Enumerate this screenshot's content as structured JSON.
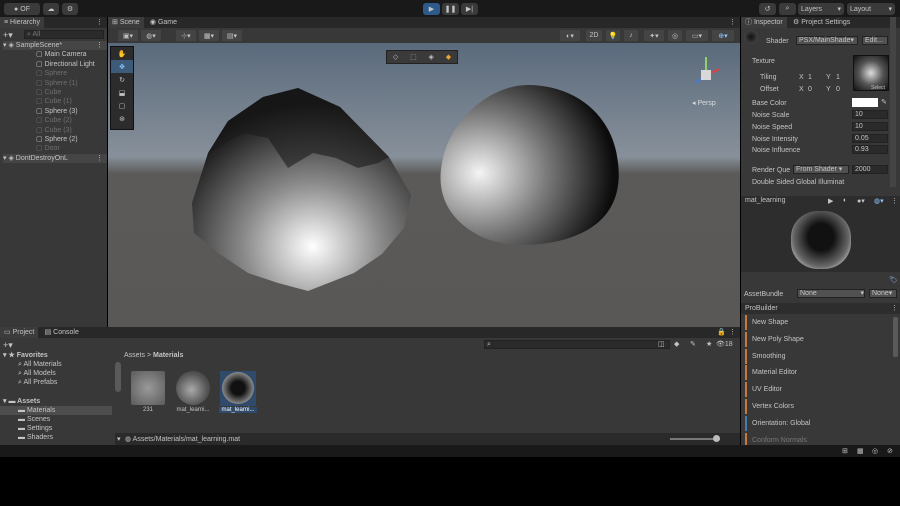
{
  "top_bar": {
    "account_label": "OF",
    "right_buttons": [
      "Layers",
      "Layout"
    ]
  },
  "hierarchy": {
    "title": "Hierarchy",
    "search_placeholder": "All",
    "items": [
      {
        "label": "SampleScene*",
        "depth": 0,
        "dim": false
      },
      {
        "label": "Main Camera",
        "depth": 1,
        "dim": false
      },
      {
        "label": "Directional Light",
        "depth": 1,
        "dim": false
      },
      {
        "label": "Sphere",
        "depth": 1,
        "dim": true
      },
      {
        "label": "Sphere (1)",
        "depth": 1,
        "dim": true
      },
      {
        "label": "Cube",
        "depth": 1,
        "dim": true
      },
      {
        "label": "Cube (1)",
        "depth": 1,
        "dim": true
      },
      {
        "label": "Sphere (3)",
        "depth": 1,
        "dim": false
      },
      {
        "label": "Cube (2)",
        "depth": 1,
        "dim": true
      },
      {
        "label": "Cube (3)",
        "depth": 1,
        "dim": true
      },
      {
        "label": "Sphere (2)",
        "depth": 1,
        "dim": false
      },
      {
        "label": "Door",
        "depth": 1,
        "dim": true
      },
      {
        "label": "DontDestroyOnL",
        "depth": 0,
        "dim": false
      }
    ]
  },
  "scene_tabs": [
    "Scene",
    "Game"
  ],
  "scene_toolbar": {
    "mode_2d": "2D",
    "persp_label": "Persp"
  },
  "bottom_tabs": [
    "Project",
    "Console"
  ],
  "project": {
    "favorites_title": "Favorites",
    "favorites": [
      "All Materials",
      "All Models",
      "All Prefabs"
    ],
    "assets_title": "Assets",
    "assets": [
      "Materials",
      "Scenes",
      "Settings",
      "Shaders"
    ],
    "breadcrumb": [
      "Assets",
      "Materials"
    ],
    "tiles": [
      "231",
      "mat_learni...",
      "mat_learni..."
    ],
    "selected_path": "Assets/Materials/mat_learning.mat",
    "count_badge": "18"
  },
  "inspector": {
    "tabs": [
      "Inspector",
      "Project Settings"
    ],
    "shader_label": "Shader",
    "shader_value": "PSX/MainShade",
    "edit_label": "Edit...",
    "texture_label": "Texture",
    "tiling_label": "Tiling",
    "tiling_x": "1",
    "tiling_y": "1",
    "offset_label": "Offset",
    "offset_x": "0",
    "offset_y": "0",
    "select_label": "Select",
    "props": [
      {
        "label": "Base Color",
        "value": ""
      },
      {
        "label": "Noise Scale",
        "value": "10"
      },
      {
        "label": "Noise Speed",
        "value": "10"
      },
      {
        "label": "Noise Intensity",
        "value": "0.05"
      },
      {
        "label": "Noise Influence",
        "value": "0.93"
      }
    ],
    "render_queue_label": "Render Que",
    "render_queue_mode": "From Shader",
    "render_queue_value": "2000",
    "double_sided_label": "Double Sided Global Illuminat",
    "preview_title": "mat_learning",
    "assetbundle_label": "AssetBundle",
    "assetbundle_value": "None",
    "assetbundle_variant": "None"
  },
  "probuilder": {
    "title": "ProBuilder",
    "items": [
      {
        "label": "New Shape",
        "color": "#c8783c"
      },
      {
        "label": "New Poly Shape",
        "color": "#c8783c"
      },
      {
        "label": "Smoothing",
        "color": "#c8783c"
      },
      {
        "label": "Material Editor",
        "color": "#c8783c"
      },
      {
        "label": "UV Editor",
        "color": "#c8783c"
      },
      {
        "label": "Vertex Colors",
        "color": "#c8783c"
      },
      {
        "label": "Orientation: Global",
        "color": "#4a7ab0"
      },
      {
        "label": "Conform Normals",
        "color": "#c8783c"
      }
    ]
  }
}
